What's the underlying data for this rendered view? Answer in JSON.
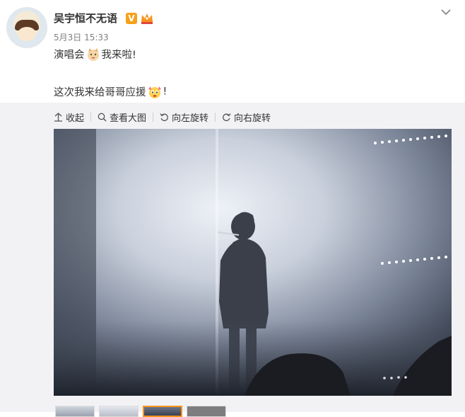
{
  "post": {
    "username": "吴宇恒不无语",
    "verified_badge": "V",
    "timestamp": "5月3日 15:33",
    "line1_before": "演唱会",
    "line1_after": "我来啦!",
    "line2_before": "这次我来给哥哥应援",
    "line2_after": "!"
  },
  "toolbar": {
    "collapse": "收起",
    "view_large": "查看大图",
    "rotate_left": "向左旋转",
    "rotate_right": "向右旋转"
  },
  "icons": {
    "avatar": "avatar-cartoon",
    "crown": "crown-icon",
    "more": "chevron-down-icon",
    "emoji1": "cat-emoji",
    "emoji2": "cheer-emoji"
  },
  "colors": {
    "accent": "#f7941d",
    "vbadge": "#f7a01a",
    "expand_bg": "#f2f2f5",
    "muted_text": "#808080"
  },
  "thumbnails": {
    "count": 4,
    "selected_index": 3
  }
}
